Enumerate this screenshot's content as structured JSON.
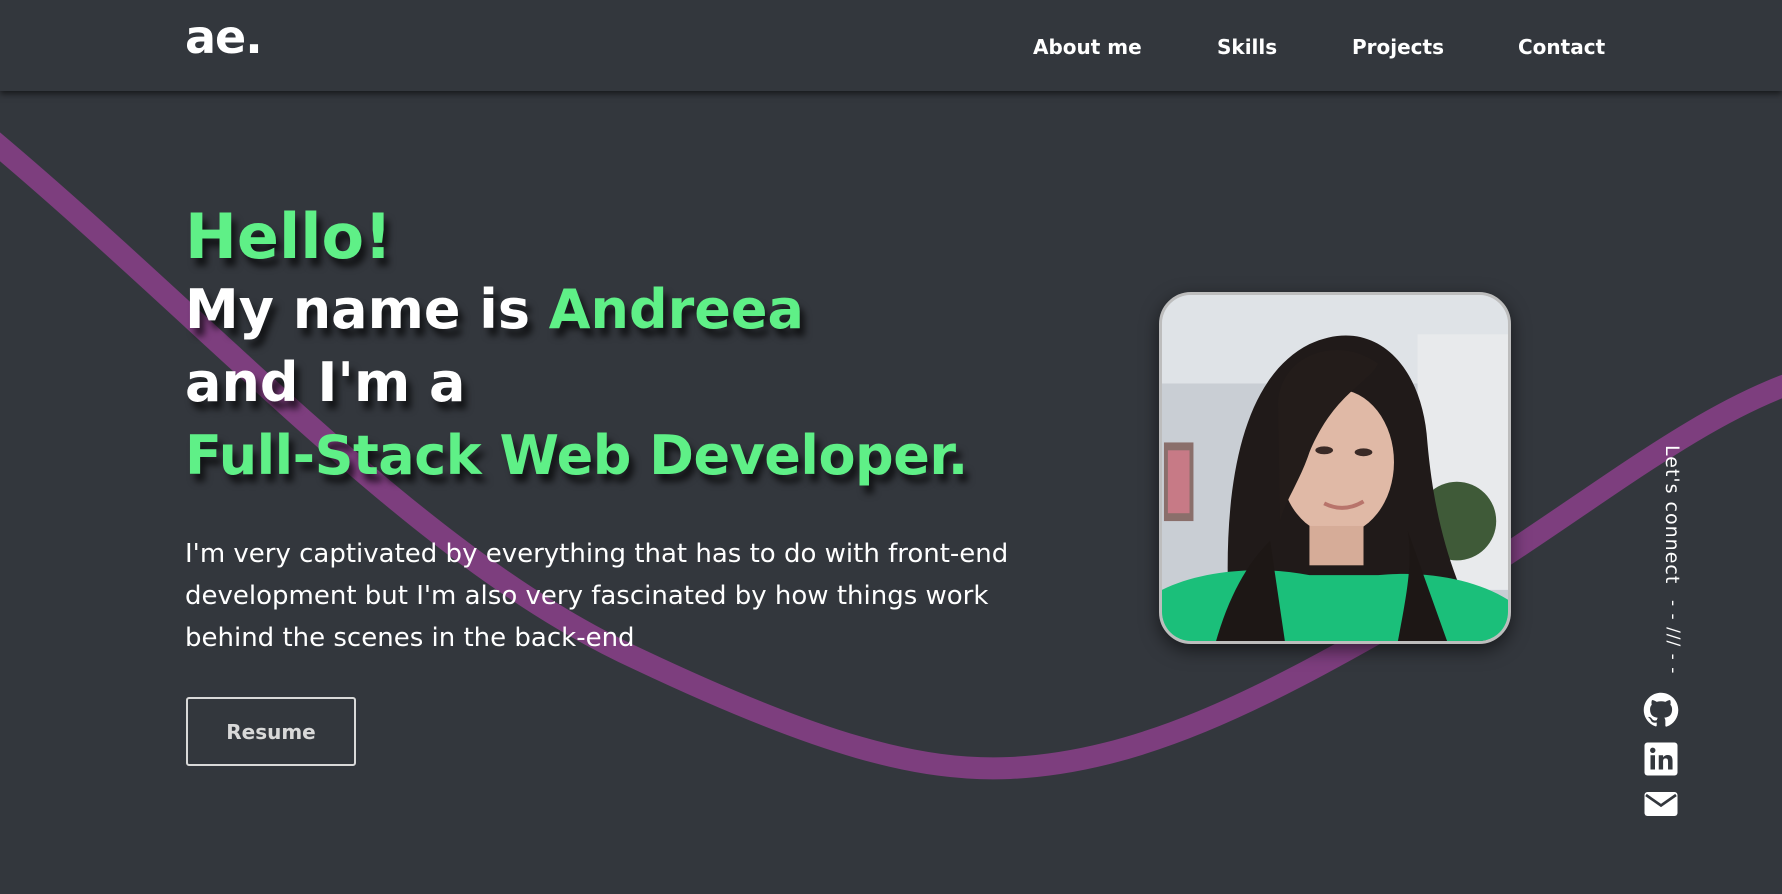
{
  "header": {
    "logo": "ae.",
    "nav": [
      {
        "label": "About me"
      },
      {
        "label": "Skills"
      },
      {
        "label": "Projects"
      },
      {
        "label": "Contact"
      }
    ]
  },
  "hero": {
    "greeting": "Hello!",
    "name_prefix": "My name is ",
    "name": "Andreea",
    "line3": "and I'm a",
    "role": "Full-Stack Web Developer.",
    "intro": "I'm very captivated by everything that has to do with front-end development but I'm also very fascinated by how things work behind the scenes in the back-end",
    "resume_label": "Resume"
  },
  "social": {
    "connect_label": "Let's connect",
    "divider": "- - /// - -",
    "links": [
      {
        "icon": "github-icon"
      },
      {
        "icon": "linkedin-icon"
      },
      {
        "icon": "email-icon"
      }
    ]
  },
  "colors": {
    "background": "#33373d",
    "accent": "#5ff087",
    "wave": "#7d3e7e",
    "text": "#ffffff"
  }
}
